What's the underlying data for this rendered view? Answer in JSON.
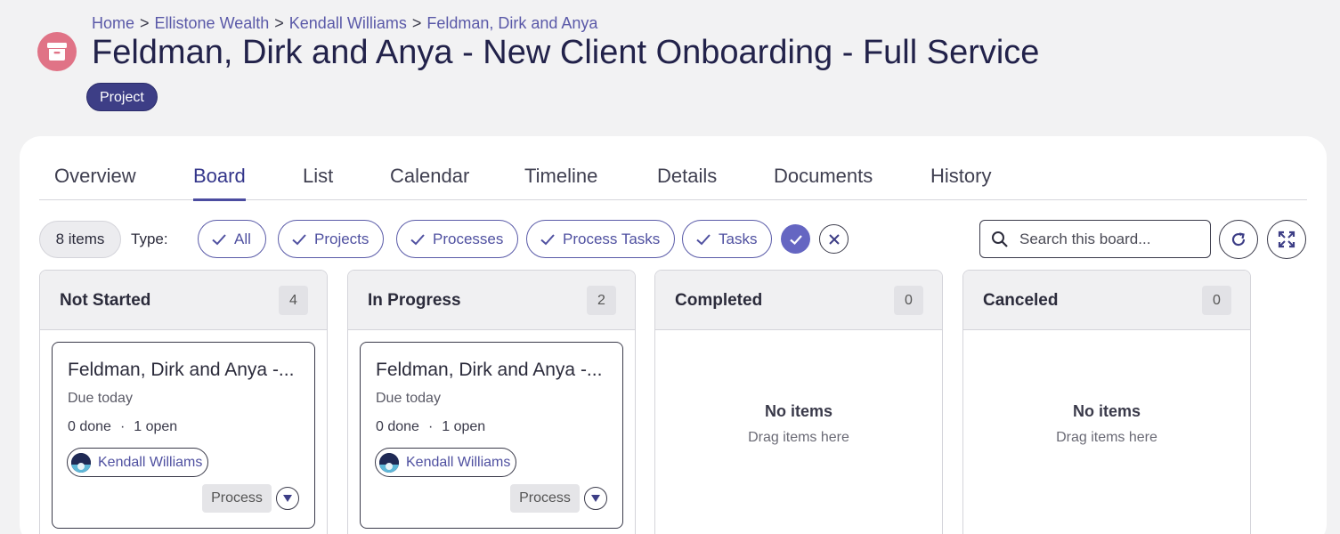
{
  "breadcrumb": {
    "items": [
      "Home",
      "Ellistone Wealth",
      "Kendall Williams",
      "Feldman, Dirk and Anya"
    ],
    "separator": ">"
  },
  "header": {
    "title": "Feldman, Dirk and Anya - New Client Onboarding - Full Service",
    "type_badge": "Project",
    "icon": "archive-box-icon",
    "icon_color": "#e07386"
  },
  "tabs": [
    "Overview",
    "Board",
    "List",
    "Calendar",
    "Timeline",
    "Details",
    "Documents",
    "History"
  ],
  "active_tab": "Board",
  "filters": {
    "count_label": "8 items",
    "type_label": "Type:",
    "chips": [
      "All",
      "Projects",
      "Processes",
      "Process Tasks",
      "Tasks"
    ]
  },
  "search": {
    "placeholder": "Search this board..."
  },
  "columns": [
    {
      "title": "Not Started",
      "count": "4",
      "card": {
        "title": "Feldman, Dirk and Anya -...",
        "due": "Due today",
        "done": "0 done",
        "dot": "·",
        "open": "1 open",
        "assignee": "Kendall Williams",
        "type": "Process"
      }
    },
    {
      "title": "In Progress",
      "count": "2",
      "card": {
        "title": "Feldman, Dirk and Anya -...",
        "due": "Due today",
        "done": "0 done",
        "dot": "·",
        "open": "1 open",
        "assignee": "Kendall Williams",
        "type": "Process"
      }
    },
    {
      "title": "Completed",
      "count": "0",
      "empty_title": "No items",
      "empty_sub": "Drag items here"
    },
    {
      "title": "Canceled",
      "count": "0",
      "empty_title": "No items",
      "empty_sub": "Drag items here"
    }
  ],
  "colors": {
    "accent": "#4f50a0",
    "badge": "#3d3e86",
    "apply": "#6566c2"
  }
}
